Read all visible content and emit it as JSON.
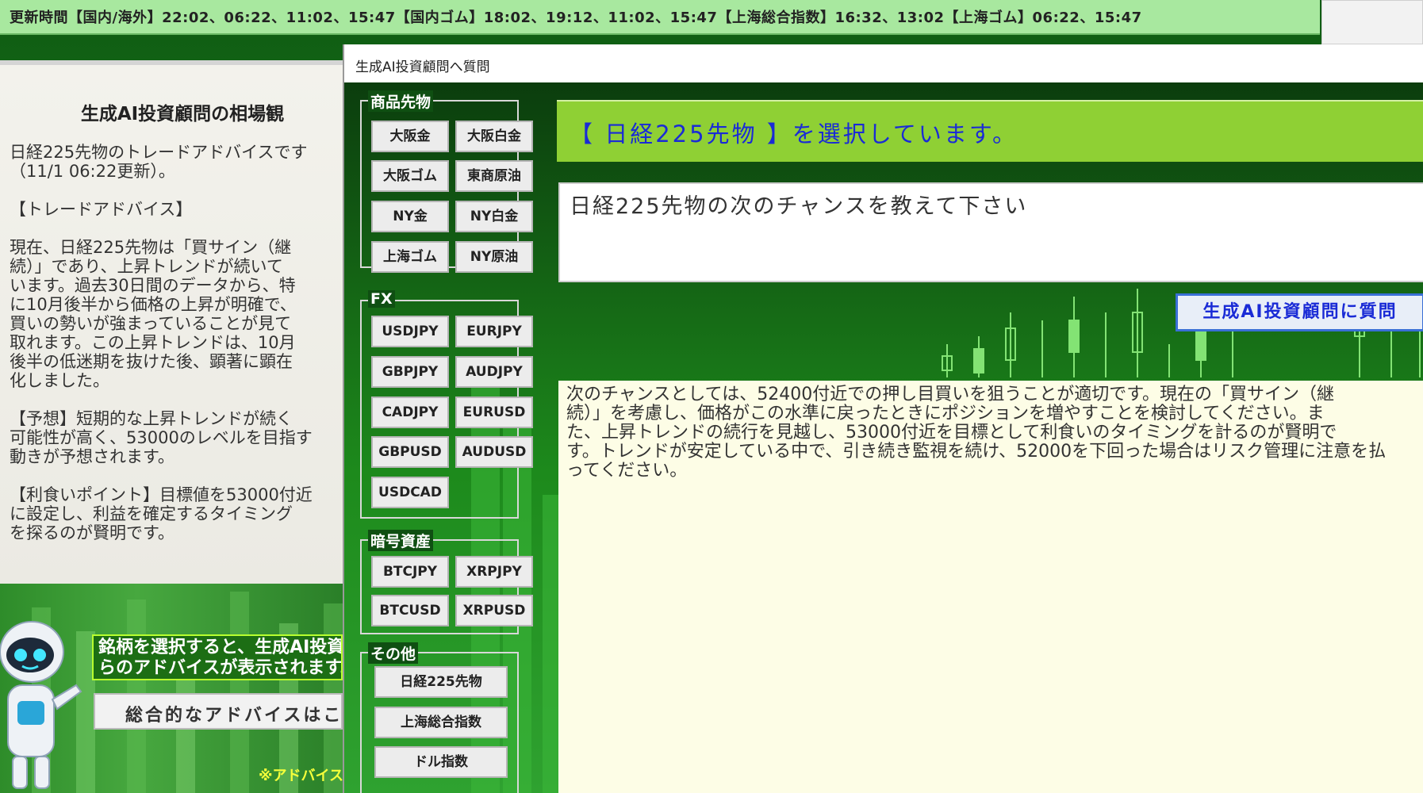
{
  "ticker": {
    "text": "更新時間【国内/海外】22:02、06:22、11:02、15:47【国内ゴム】18:02、19:12、11:02、15:47【上海総合指数】16:32、13:02【上海ゴム】06:22、15:47"
  },
  "left_panel": {
    "title": "生成AI投資顧問の相場観",
    "body": "日経225先物のトレードアドバイスです\n（11/1 06:22更新）。\n\n【トレードアドバイス】\n\n現在、日経225先物は「買サイン（継\n続）」であり、上昇トレンドが続いて\nいます。過去30日間のデータから、特\nに10月後半から価格の上昇が明確で、\n買いの勢いが強まっていることが見て\n取れます。この上昇トレンドは、10月\n後半の低迷期を抜けた後、顕著に顕在\n化しました。\n\n【予想】短期的な上昇トレンドが続く\n可能性が高く、53000のレベルを目指す\n動きが予想されます。\n\n【利食いポイント】目標値を53000付近\nに設定し、利益を確定するタイミング\nを探るのが賢明です。",
    "banner": "銘柄を選択すると、生成AI投資\nらのアドバイスが表示されます。",
    "advice_button": "総合的なアドバイスはこ",
    "note": "※アドバイスの"
  },
  "dialog": {
    "title": "生成AI投資顧問へ質問",
    "groups": {
      "commodities": {
        "label": "商品先物",
        "buttons": [
          "大阪金",
          "大阪白金",
          "大阪ゴム",
          "東商原油",
          "NY金",
          "NY白金",
          "上海ゴム",
          "NY原油"
        ]
      },
      "fx": {
        "label": "FX",
        "buttons": [
          "USDJPY",
          "EURJPY",
          "GBPJPY",
          "AUDJPY",
          "CADJPY",
          "EURUSD",
          "GBPUSD",
          "AUDUSD",
          "USDCAD"
        ]
      },
      "crypto": {
        "label": "暗号資産",
        "buttons": [
          "BTCJPY",
          "XRPJPY",
          "BTCUSD",
          "XRPUSD"
        ]
      },
      "other": {
        "label": "その他",
        "buttons": [
          "日経225先物",
          "上海総合指数",
          "ドル指数"
        ]
      }
    },
    "selected": "【 日経225先物 】を選択しています。",
    "question": "日経225先物の次のチャンスを教えて下さい",
    "ask_button": "生成AI投資顧問に質問",
    "answer": "次のチャンスとしては、52400付近での押し目買いを狙うことが適切です。現在の「買サイン（継\n続）」を考慮し、価格がこの水準に戻ったときにポジションを増やすことを検討してください。ま\nた、上昇トレンドの続行を見越し、53000付近を目標として利食いのタイミングを計るのが賢明で\nす。トレンドが安定している中で、引き続き監視を続け、52000を下回った場合はリスク管理に注意を払\nってください。"
  },
  "colors": {
    "ticker_bg": "#a8e89f",
    "selected_bar": "#8fd034",
    "selected_text": "#1a2bd6",
    "answer_bg": "#fdfde6",
    "banner_border": "#b8ff2f"
  }
}
